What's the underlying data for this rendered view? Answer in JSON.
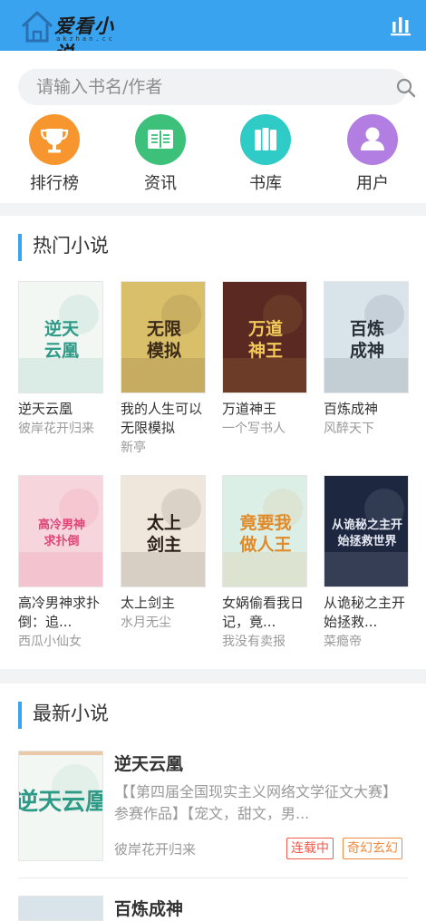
{
  "header": {
    "logo_text": "爱看小说",
    "logo_sub": "akzhan.cc",
    "stats_icon": "bar-chart-icon"
  },
  "search": {
    "placeholder": "请输入书名/作者",
    "icon": "search-icon"
  },
  "nav": [
    {
      "label": "排行榜",
      "icon": "trophy-icon",
      "color": "#f7962f"
    },
    {
      "label": "资讯",
      "icon": "book-open-icon",
      "color": "#3cc07a"
    },
    {
      "label": "书库",
      "icon": "books-icon",
      "color": "#2fcbc6"
    },
    {
      "label": "用户",
      "icon": "user-icon",
      "color": "#b27ee2"
    }
  ],
  "hot": {
    "title": "热门小说",
    "books": [
      {
        "title": "逆天云凰",
        "author": "彼岸花开归来",
        "cover_text": "逆天云凰",
        "cover_bg": "#f3f7f3",
        "cover_fg": "#2c9a86"
      },
      {
        "title": "我的人生可以无限模拟",
        "author": "新亭",
        "cover_text": "无限模拟",
        "cover_bg": "#d9bf6a",
        "cover_fg": "#3c2a18"
      },
      {
        "title": "万道神王",
        "author": "一个写书人",
        "cover_text": "万道神王",
        "cover_bg": "#5a2a22",
        "cover_fg": "#f2c95a"
      },
      {
        "title": "百炼成神",
        "author": "风醉天下",
        "cover_text": "百炼成神",
        "cover_bg": "#d9e3ea",
        "cover_fg": "#2a3138"
      },
      {
        "title": "高冷男神求扑倒：追...",
        "author": "西瓜小仙女",
        "cover_text": "高冷男神求扑倒",
        "cover_bg": "#f6d6dc",
        "cover_fg": "#e0457a"
      },
      {
        "title": "太上剑主",
        "author": "水月无尘",
        "cover_text": "太上剑主",
        "cover_bg": "#efe7dc",
        "cover_fg": "#2a1f18"
      },
      {
        "title": "女娲偷看我日记，竟...",
        "author": "我没有卖报",
        "cover_text": "竟要我做人王",
        "cover_bg": "#dcefe7",
        "cover_fg": "#e08a2a"
      },
      {
        "title": "从诡秘之主开始拯救...",
        "author": "菜瘾帝",
        "cover_text": "从诡秘之主开始拯救世界",
        "cover_bg": "#1d2740",
        "cover_fg": "#e6e9f2"
      }
    ]
  },
  "new": {
    "title": "最新小说",
    "items": [
      {
        "title": "逆天云凰",
        "intro": "【【第四届全国现实主义网络文学征文大赛】参赛作品】【宠文，甜文，男...",
        "author": "彼岸花开归来",
        "status": "连载中",
        "genre": "奇幻玄幻",
        "cover_text": "逆天云凰",
        "cover_bg": "#f3f7f3",
        "cover_fg": "#2c9a86"
      },
      {
        "title": "百炼成神",
        "cover_bg": "#d9e3ea"
      }
    ]
  },
  "colors": {
    "primary": "#3aa3ef",
    "tag_red": "#ef5a4b",
    "tag_orange": "#f18b3d"
  }
}
